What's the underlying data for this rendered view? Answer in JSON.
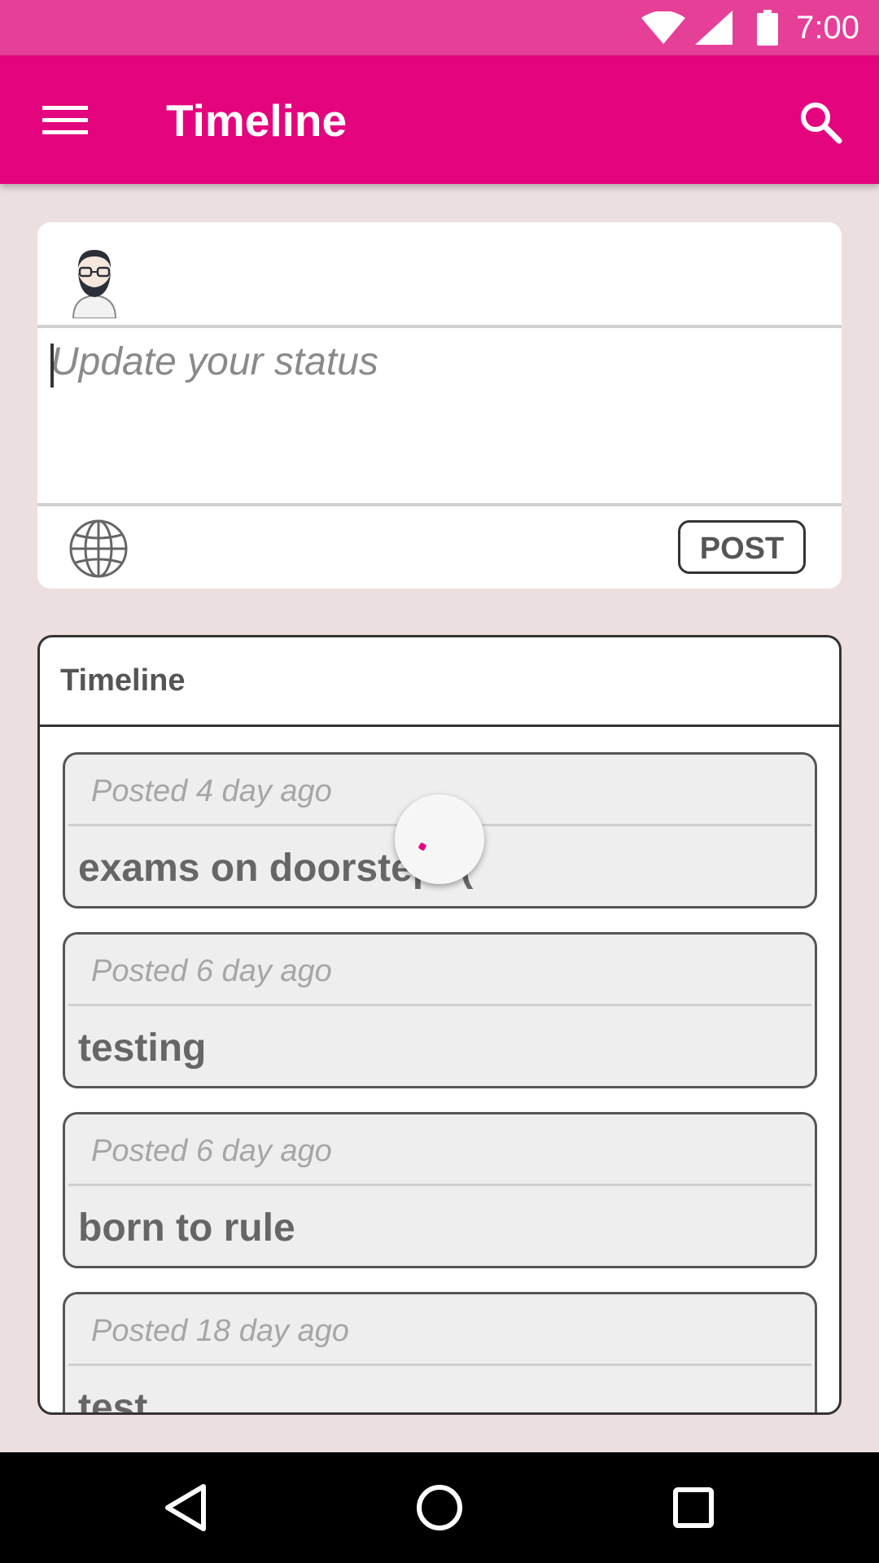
{
  "status_bar": {
    "time": "7:00",
    "icons": [
      "wifi-icon",
      "signal-icon",
      "battery-icon"
    ]
  },
  "app_bar": {
    "title": "Timeline",
    "menu_icon": "menu-icon",
    "search_icon": "search-icon",
    "color": "#e4057e"
  },
  "composer": {
    "placeholder": "Update your status",
    "value": "",
    "post_label": "POST",
    "avatar_icon": "avatar-icon",
    "privacy_icon": "globe-icon"
  },
  "timeline": {
    "title": "Timeline",
    "posts": [
      {
        "meta": "Posted 4 day ago",
        "text": "exams on doorstep :("
      },
      {
        "meta": "Posted 6 day ago",
        "text": "testing"
      },
      {
        "meta": "Posted 6 day ago",
        "text": "born to rule"
      },
      {
        "meta": "Posted 18 day ago",
        "text": "test"
      }
    ]
  },
  "nav_bar": {
    "icons": [
      "back-icon",
      "home-icon",
      "recents-icon"
    ]
  },
  "colors": {
    "accent": "#e4057e",
    "status_bar": "#e63f98",
    "background": "#ecdfdf"
  }
}
